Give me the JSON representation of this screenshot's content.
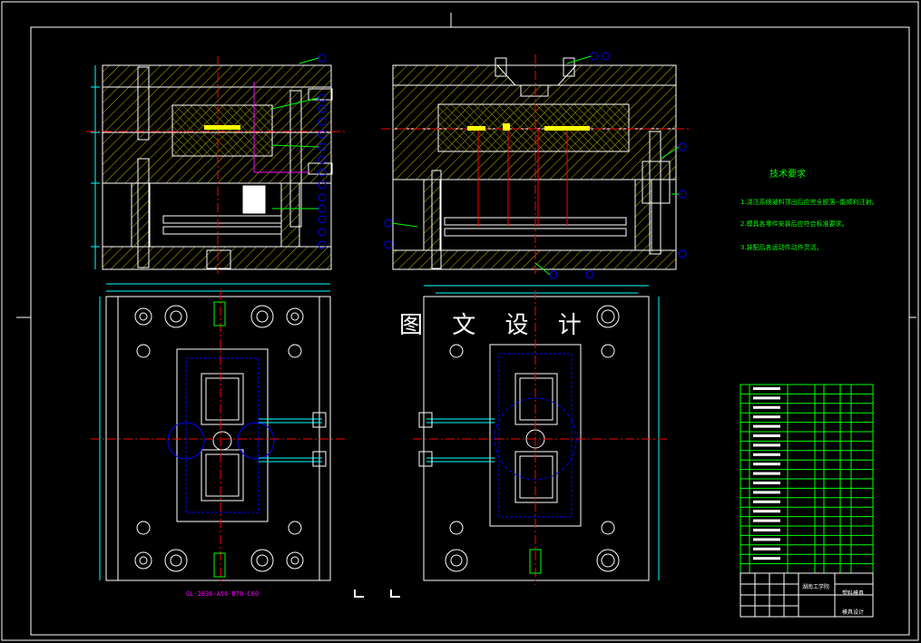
{
  "watermark": "图 文 设 计",
  "tech_requirements": {
    "title": "技术要求",
    "lines": [
      "1.浇注系统凝料顶出后应完全脱落--能顺利注射。",
      "2.模具各零件安装后应符合标准要求。",
      "3.装配后各运动件动作灵活。"
    ]
  },
  "part_number": "GL-2836-A56-B70-C60",
  "title_block": {
    "school": "湖南工学院",
    "drawing": "塑料模具",
    "designer": "模具设计"
  },
  "colors": {
    "background": "#000000",
    "frame": "#ffffff",
    "hatch": "#ffff00",
    "centerline": "#ff0000",
    "hidden": "#0000ff",
    "dimension": "#00ffff",
    "annotation": "#00ff00",
    "marker": "#ff00ff"
  }
}
